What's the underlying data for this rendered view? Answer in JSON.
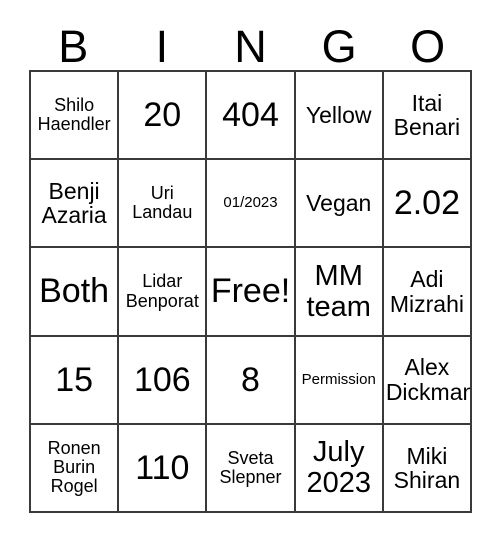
{
  "card": {
    "title": "BINGO",
    "header_letters": [
      "B",
      "I",
      "N",
      "G",
      "O"
    ],
    "columns": 5,
    "rows": 5,
    "border_color": "#3a3a3a",
    "background_color": "#ffffff",
    "text_color": "#000000",
    "free_space": {
      "row": 3,
      "column": 3,
      "label": "Free!"
    },
    "cells": [
      [
        {
          "text": "Shilo\nHaendler",
          "size": "sm"
        },
        {
          "text": "20",
          "size": "xl"
        },
        {
          "text": "404",
          "size": "xl"
        },
        {
          "text": "Yellow",
          "size": "md"
        },
        {
          "text": "Itai\nBenari",
          "size": "md"
        }
      ],
      [
        {
          "text": "Benji\nAzaria",
          "size": "md"
        },
        {
          "text": "Uri\nLandau",
          "size": "sm"
        },
        {
          "text": "01/2023",
          "size": "xs"
        },
        {
          "text": "Vegan",
          "size": "md"
        },
        {
          "text": "2.02",
          "size": "xl"
        }
      ],
      [
        {
          "text": "Both",
          "size": "xl"
        },
        {
          "text": "Lidar\nBenporat",
          "size": "sm"
        },
        {
          "text": "Free!",
          "size": "xl"
        },
        {
          "text": "MM\nteam",
          "size": "lg"
        },
        {
          "text": "Adi\nMizrahi",
          "size": "md"
        }
      ],
      [
        {
          "text": "15",
          "size": "xl"
        },
        {
          "text": "106",
          "size": "xl"
        },
        {
          "text": "8",
          "size": "xl"
        },
        {
          "text": "Permission",
          "size": "xs"
        },
        {
          "text": "Alex\nDickman",
          "size": "md"
        }
      ],
      [
        {
          "text": "Ronen\nBurin\nRogel",
          "size": "sm"
        },
        {
          "text": "110",
          "size": "xl"
        },
        {
          "text": "Sveta\nSlepner",
          "size": "sm"
        },
        {
          "text": "July\n2023",
          "size": "lg"
        },
        {
          "text": "Miki\nShiran",
          "size": "md"
        }
      ]
    ]
  }
}
